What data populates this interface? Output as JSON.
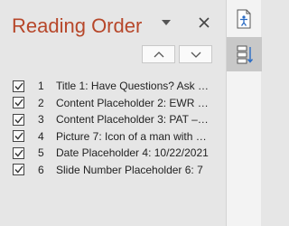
{
  "pane": {
    "title": "Reading Order",
    "menu_icon": "caret-down-icon",
    "close_icon": "close-icon",
    "move_up_icon": "chevron-up-icon",
    "move_down_icon": "chevron-down-icon"
  },
  "items": [
    {
      "num": "1",
      "label": "Title 1: Have Questions? Ask y…",
      "checked": true
    },
    {
      "num": "2",
      "label": "Content Placeholder 2: EWR –…",
      "checked": true
    },
    {
      "num": "3",
      "label": "Content Placeholder 3: PAT – J…",
      "checked": true
    },
    {
      "num": "4",
      "label": "Picture 7: Icon of a man with a…",
      "checked": true
    },
    {
      "num": "5",
      "label": "Date Placeholder 4: 10/22/2021",
      "checked": true
    },
    {
      "num": "6",
      "label": "Slide Number Placeholder 6: 7",
      "checked": true
    }
  ],
  "sidebar": {
    "buttons": [
      {
        "icon": "accessibility-check-icon",
        "active": false
      },
      {
        "icon": "reading-order-icon",
        "active": true
      }
    ]
  },
  "colors": {
    "title": "#b7472a",
    "accent_blue": "#2b6cc4",
    "pane_bg": "#e6e6e6",
    "sidebar_bg": "#f3f3f3",
    "active_bg": "#c8c8c8"
  }
}
